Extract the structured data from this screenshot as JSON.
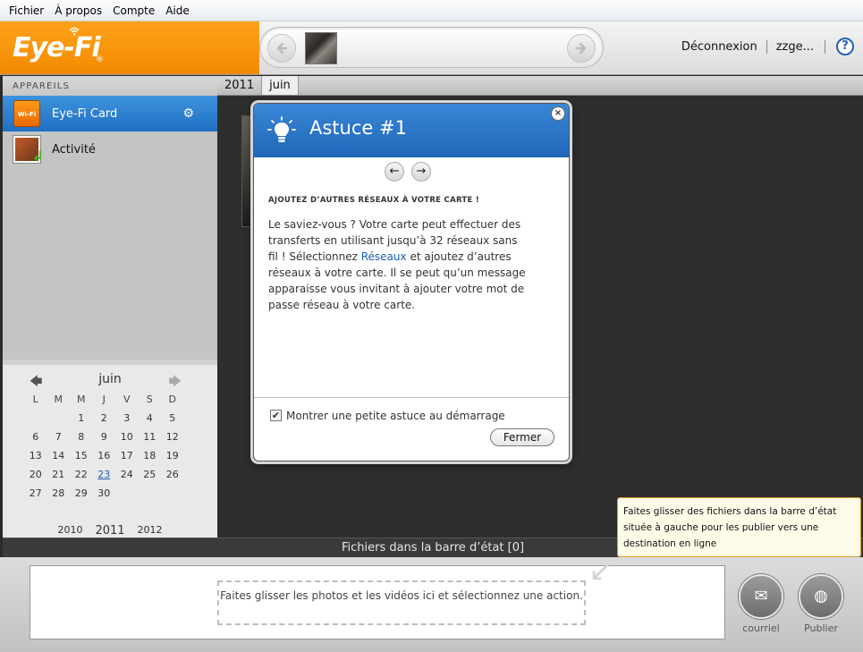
{
  "menu": {
    "items": [
      "Fichier",
      "À propos",
      "Compte",
      "Aide"
    ]
  },
  "header": {
    "logo": "Eye-Fi",
    "logo_reg": "®",
    "logout_label": "Déconnexion",
    "user_label": "zzge...",
    "help_icon": "?"
  },
  "sidebar": {
    "section_title": "APPAREILS",
    "devices": [
      {
        "label": "Eye-Fi Card",
        "icon": "card-icon",
        "icon_text": "Wi-Fi"
      },
      {
        "label": "Activité",
        "icon": "activity-icon"
      }
    ]
  },
  "calendar": {
    "month": "juin",
    "weekdays": [
      "L",
      "M",
      "M",
      "J",
      "V",
      "S",
      "D"
    ],
    "weeks": [
      [
        "",
        "",
        "1",
        "2",
        "3",
        "4",
        "5"
      ],
      [
        "6",
        "7",
        "8",
        "9",
        "10",
        "11",
        "12"
      ],
      [
        "13",
        "14",
        "15",
        "16",
        "17",
        "18",
        "19"
      ],
      [
        "20",
        "21",
        "22",
        "23",
        "24",
        "25",
        "26"
      ],
      [
        "27",
        "28",
        "29",
        "30",
        "",
        "",
        ""
      ]
    ],
    "today": "23",
    "years": [
      "2010",
      "2011",
      "2012"
    ],
    "current_year": "2011"
  },
  "breadcrumb": {
    "year": "2011",
    "month": "juin"
  },
  "dialog": {
    "title": "Astuce #1",
    "heading": "AJOUTEZ D’AUTRES RÉSEAUX À VOTRE CARTE !",
    "body_before": "Le saviez-vous ? Votre carte peut effectuer des transferts en utilisant jusqu’à 32 réseaux sans fil ! Sélectionnez ",
    "body_link": "Réseaux",
    "body_after": " et ajoutez d’autres réseaux à votre carte. Il se peut qu’un message apparaisse vous invitant à ajouter votre mot de passe réseau à votre carte.",
    "checkbox_label": "Montrer une petite astuce au démarrage",
    "checkbox_checked": true,
    "close_button": "Fermer",
    "close_icon": "×"
  },
  "status_bar": {
    "title": "Fichiers dans la barre d’état [0]",
    "drop_hint": "Faites glisser les photos et les vidéos ici et sélectionnez une action.",
    "tooltip": "Faites glisser des fichiers dans la barre d’état située à gauche pour les publier vers une destination en ligne",
    "actions": [
      {
        "label": "courriel",
        "icon": "email-icon"
      },
      {
        "label": "Publier",
        "icon": "www-icon"
      }
    ]
  },
  "colors": {
    "brand_orange": "#f28a00",
    "accent_blue": "#1f6fc2",
    "link_blue": "#1b5fb8"
  }
}
